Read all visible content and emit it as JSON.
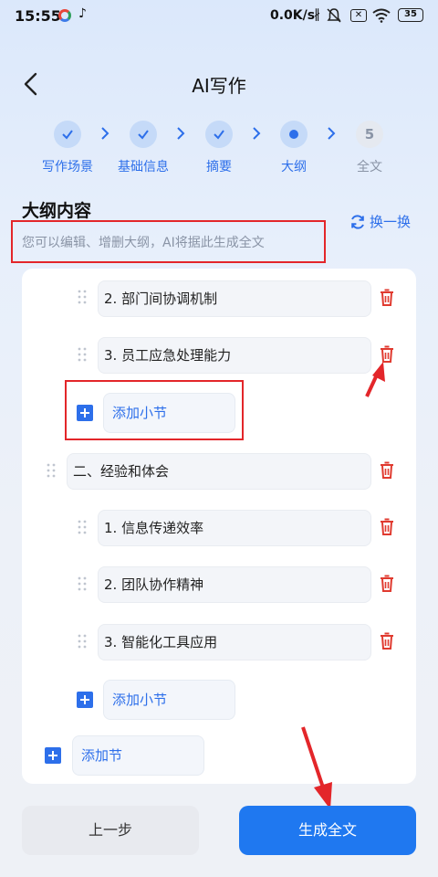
{
  "status_bar": {
    "time": "15:55",
    "speed": "0.0K/s",
    "bluetooth": "∦",
    "sim": "✕",
    "battery": "35"
  },
  "header": {
    "title": "AI写作"
  },
  "steps": [
    {
      "label": "写作场景",
      "state": "done"
    },
    {
      "label": "基础信息",
      "state": "done"
    },
    {
      "label": "摘要",
      "state": "done"
    },
    {
      "label": "大纲",
      "state": "current"
    },
    {
      "label": "全文",
      "state": "pending",
      "number": "5"
    }
  ],
  "outline": {
    "title": "大纲内容",
    "subtitle": "您可以编辑、增删大纲，AI将据此生成全文",
    "refresh_label": "换一换"
  },
  "items": [
    {
      "text": "2. 部门间协调机制"
    },
    {
      "text": "3. 员工应急处理能力"
    },
    {
      "text": "二、经验和体会"
    },
    {
      "text": "1. 信息传递效率"
    },
    {
      "text": "2. 团队协作精神"
    },
    {
      "text": "3. 智能化工具应用"
    }
  ],
  "add_subsection_label": "添加小节",
  "add_section_label": "添加节",
  "footer": {
    "prev_label": "上一步",
    "generate_label": "生成全文"
  }
}
